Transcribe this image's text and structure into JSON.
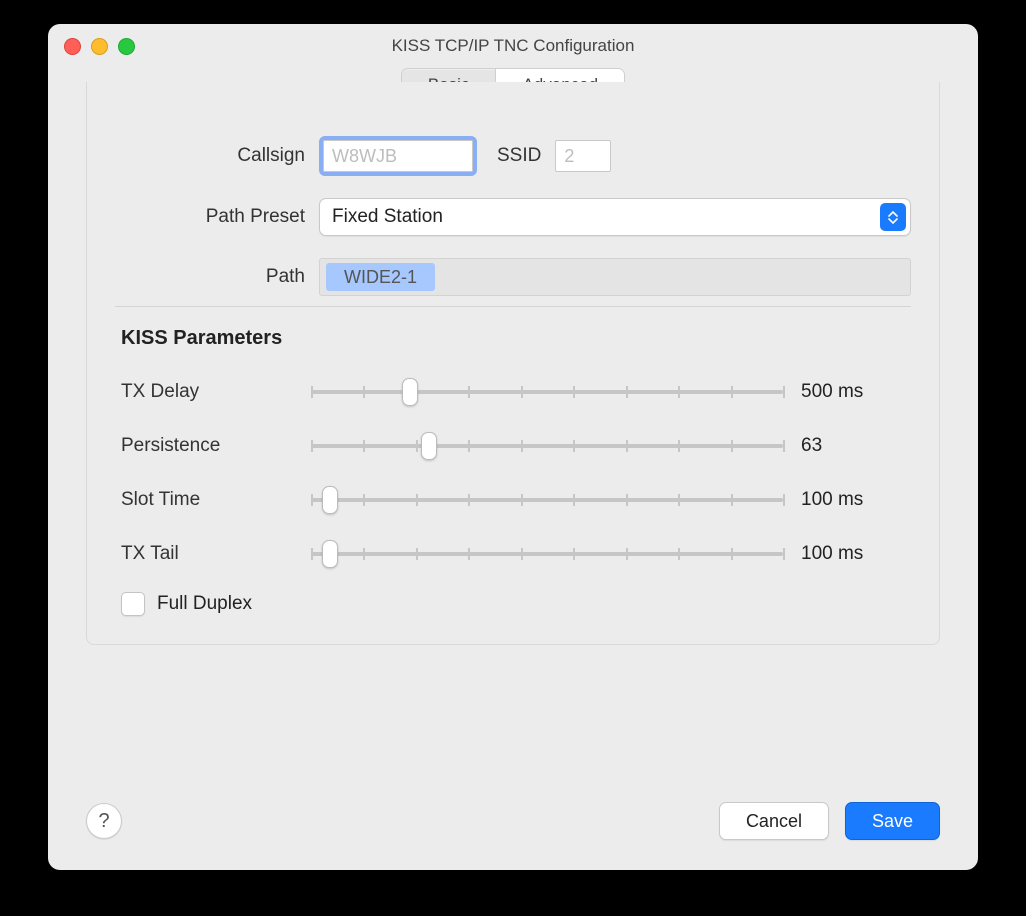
{
  "window": {
    "title": "KISS TCP/IP TNC Configuration"
  },
  "tabs": {
    "basic": "Basic",
    "advanced": "Advanced",
    "active": "advanced"
  },
  "form": {
    "callsign_label": "Callsign",
    "callsign_value": "",
    "callsign_placeholder": "W8WJB",
    "ssid_label": "SSID",
    "ssid_value": "",
    "ssid_placeholder": "2",
    "path_preset_label": "Path Preset",
    "path_preset_value": "Fixed Station",
    "path_label": "Path",
    "path_tokens": [
      "WIDE2-1"
    ]
  },
  "kiss": {
    "heading": "KISS Parameters",
    "sliders": [
      {
        "label": "TX Delay",
        "value_text": "500 ms",
        "position": 0.21,
        "ticks": 10
      },
      {
        "label": "Persistence",
        "value_text": "63",
        "position": 0.25,
        "ticks": 10
      },
      {
        "label": "Slot Time",
        "value_text": "100 ms",
        "position": 0.04,
        "ticks": 10
      },
      {
        "label": "TX Tail",
        "value_text": "100 ms",
        "position": 0.04,
        "ticks": 10
      }
    ],
    "full_duplex_label": "Full Duplex",
    "full_duplex_checked": false
  },
  "footer": {
    "help": "?",
    "cancel": "Cancel",
    "save": "Save"
  }
}
